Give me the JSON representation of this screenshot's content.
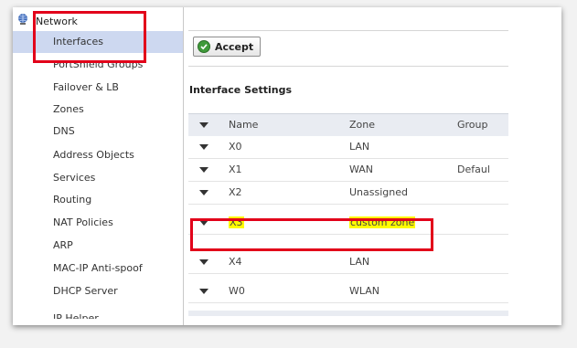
{
  "sidebar": {
    "root_label": "Network",
    "items": [
      {
        "label": "Interfaces",
        "active": true
      },
      {
        "label": "PortShield Groups"
      },
      {
        "label": "Failover & LB"
      },
      {
        "label": "Zones"
      },
      {
        "label": "DNS"
      },
      {
        "label": "Address Objects"
      },
      {
        "label": "Services"
      },
      {
        "label": "Routing"
      },
      {
        "label": "NAT Policies"
      },
      {
        "label": "ARP"
      },
      {
        "label": "MAC-IP Anti-spoof"
      },
      {
        "label": "DHCP Server"
      },
      {
        "label": "IP Helper"
      }
    ]
  },
  "toolbar": {
    "accept_label": "Accept"
  },
  "section_title": "Interface Settings",
  "table": {
    "headers": {
      "name": "Name",
      "zone": "Zone",
      "group": "Group"
    },
    "rows": [
      {
        "name": "X0",
        "zone": "LAN",
        "group": ""
      },
      {
        "name": "X1",
        "zone": "WAN",
        "group": "Default"
      },
      {
        "name": "X2",
        "zone": "Unassigned",
        "group": ""
      },
      {
        "name": "X3",
        "zone": "custom zone",
        "group": "",
        "highlight": true
      },
      {
        "name": "X4",
        "zone": "LAN",
        "group": ""
      },
      {
        "name": "W0",
        "zone": "WLAN",
        "group": ""
      }
    ]
  },
  "colors": {
    "highlight": "#fffc00",
    "callout_box": "#e2001a",
    "active_nav": "#cdd8f0"
  }
}
